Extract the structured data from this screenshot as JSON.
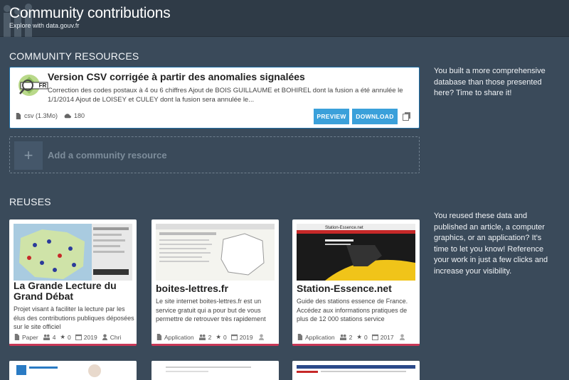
{
  "header": {
    "title": "Community contributions",
    "subtitle": "Explore with data.gouv.fr"
  },
  "sections": {
    "community_resources": "COMMUNITY RESOURCES",
    "reuses": "REUSES"
  },
  "resource": {
    "title": "Version CSV corrigée à partir des anomalies signalées",
    "description": "Correction des codes postaux à 4 ou 6 chiffres Ajout de BOIS GUILLAUME et BOHIREL dont la fusion a été annulée le 1/1/2014 Ajout de LOISEY et CULEY dont la fusion sera annulée le...",
    "format": "csv (1.3Mo)",
    "downloads": "180",
    "preview_label": "PREVIEW",
    "download_label": "DOWNLOAD",
    "logo_text": "FR"
  },
  "add_resource_label": "Add a community resource",
  "side_resources": "You built a more comprehensive database than those presented here? Time to share it!",
  "side_reuses": "You reused these data and published an article, a computer graphics, or an application? It's time to let you know! Reference your work in just a few clicks and increase your visibility.",
  "reuses": [
    {
      "title": "La Grande Lecture du Grand Débat",
      "description": "Projet visant à faciliter la lecture par les élus des contributions publiques déposées sur le site officiel",
      "type": "Paper",
      "followers": "4",
      "stars": "0",
      "year": "2019",
      "author": "Chri"
    },
    {
      "title": "boites-lettres.fr",
      "description": "Le site internet boites-lettres.fr est un service gratuit qui a pour but de vous permettre de retrouver très rapidement",
      "type": "Application",
      "followers": "2",
      "stars": "0",
      "year": "2019"
    },
    {
      "title": "Station-Essence.net",
      "description": "Guide des stations essence de France. Accédez aux informations pratiques de plus de 12 000 stations service",
      "type": "Application",
      "followers": "2",
      "stars": "0",
      "year": "2017",
      "thumb_caption": "Station-Essence.net"
    }
  ],
  "colors": {
    "background": "#3a4a5a",
    "accent": "#3aa0da",
    "card_border": "#c93857"
  }
}
